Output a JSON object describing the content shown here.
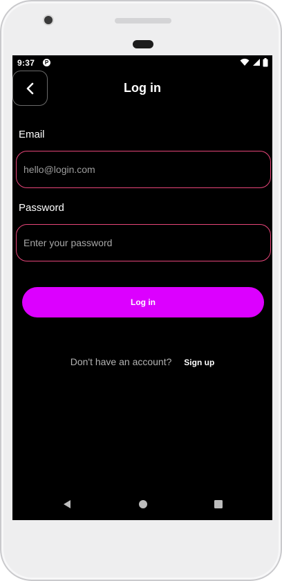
{
  "status_bar": {
    "time": "9:37",
    "app_indicator": "P",
    "icons": [
      "wifi-icon",
      "signal-icon",
      "battery-icon"
    ]
  },
  "header": {
    "back_icon": "chevron-left-icon",
    "title": "Log in"
  },
  "form": {
    "email_label": "Email",
    "email_value": "hello@login.com",
    "password_label": "Password",
    "password_placeholder": "Enter your password",
    "submit_label": "Log in"
  },
  "signup": {
    "question": "Don't have an account?",
    "link": "Sign up"
  },
  "nav_bar": {
    "icons": [
      "back-triangle-icon",
      "home-circle-icon",
      "recents-square-icon"
    ]
  },
  "colors": {
    "background": "#000000",
    "accent_button": "#dc00ff",
    "field_border": "#e8467a"
  }
}
